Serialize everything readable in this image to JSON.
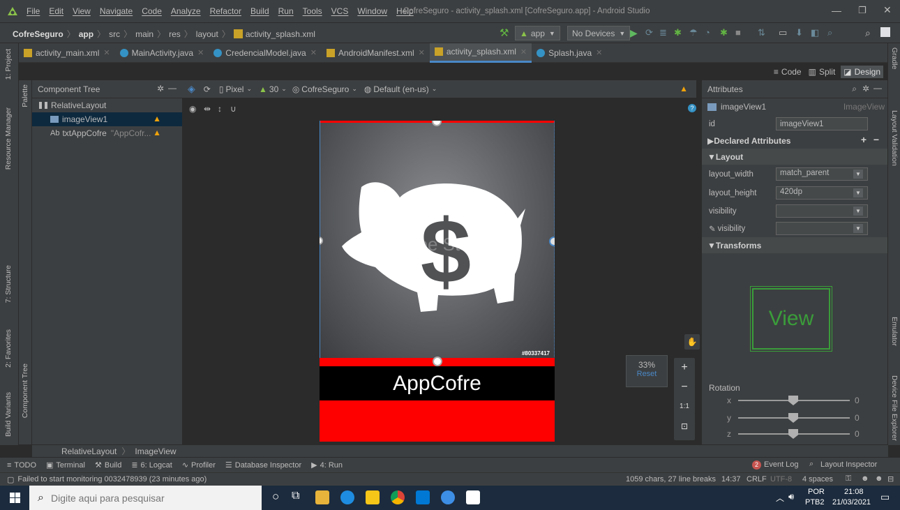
{
  "menu": {
    "items": [
      "File",
      "Edit",
      "View",
      "Navigate",
      "Code",
      "Analyze",
      "Refactor",
      "Build",
      "Run",
      "Tools",
      "VCS",
      "Window",
      "Help"
    ],
    "window_title": "CofreSeguro - activity_splash.xml [CofreSeguro.app] - Android Studio"
  },
  "nav": {
    "crumbs": [
      "CofreSeguro",
      "app",
      "src",
      "main",
      "res",
      "layout",
      "activity_splash.xml"
    ],
    "run_config": "app",
    "device": "No Devices"
  },
  "tabs": [
    {
      "label": "activity_main.xml"
    },
    {
      "label": "MainActivity.java"
    },
    {
      "label": "CredencialModel.java"
    },
    {
      "label": "AndroidManifest.xml"
    },
    {
      "label": "activity_splash.xml"
    },
    {
      "label": "Splash.java"
    }
  ],
  "view_modes": {
    "code": "Code",
    "split": "Split",
    "design": "Design"
  },
  "left_tools": {
    "project": "1: Project",
    "resource_manager": "Resource Manager",
    "palette": "Palette",
    "structure": "7: Structure",
    "favorites": "2: Favorites",
    "build_variants": "Build Variants",
    "component_tree": "Component Tree"
  },
  "right_tools": {
    "gradle": "Gradle",
    "layout_validation": "Layout Validation",
    "emulator": "Emulator",
    "device_file_explorer": "Device File Explorer"
  },
  "component_tree": {
    "title": "Component Tree",
    "root": "RelativeLayout",
    "items": [
      {
        "label": "imageView1",
        "extra": ""
      },
      {
        "label": "txtAppCofre",
        "extra": "\"AppCofr..."
      }
    ]
  },
  "design_toolbar": {
    "device": "Pixel",
    "api": "30",
    "theme": "CofreSeguro",
    "locale": "Default (en-us)"
  },
  "canvas": {
    "watermark": "Adobe Stock",
    "stock_id": "#80337417",
    "app_text": "AppCofre",
    "zoom": "33%",
    "reset": "Reset",
    "one_to_one": "1:1"
  },
  "attributes": {
    "title": "Attributes",
    "component_name": "imageView1",
    "component_type": "ImageView",
    "id_label": "id",
    "id_value": "imageView1",
    "declared": "Declared Attributes",
    "layout_section": "Layout",
    "rows": [
      {
        "label": "layout_width",
        "value": "match_parent"
      },
      {
        "label": "layout_height",
        "value": "420dp"
      },
      {
        "label": "visibility",
        "value": ""
      },
      {
        "label": "visibility",
        "value": ""
      }
    ],
    "transforms": "Transforms",
    "view_label": "View",
    "rotation": "Rotation",
    "axes": [
      {
        "axis": "x",
        "value": "0"
      },
      {
        "axis": "y",
        "value": "0"
      },
      {
        "axis": "z",
        "value": "0"
      }
    ]
  },
  "breadcrumb2": [
    "RelativeLayout",
    "ImageView"
  ],
  "toolwindows": {
    "items": [
      "TODO",
      "Terminal",
      "Build",
      "6: Logcat",
      "Profiler",
      "Database Inspector",
      "4: Run"
    ],
    "event_log_count": "2",
    "event_log": "Event Log",
    "layout_inspector": "Layout Inspector"
  },
  "status": {
    "message": "Failed to start monitoring 0032478939 (23 minutes ago)",
    "chars": "1059 chars, 27 line breaks",
    "pos": "14:37",
    "crlf": "CRLF",
    "encoding": "UTF-8",
    "indent": "4 spaces"
  },
  "taskbar": {
    "search_placeholder": "Digite aqui para pesquisar",
    "lang_top": "POR",
    "lang_bottom": "PTB2",
    "time": "21:08",
    "date": "21/03/2021"
  },
  "colors": {
    "accent": "#4a88c7",
    "selection_red": "#ff0000",
    "warning": "#f0a30a"
  }
}
